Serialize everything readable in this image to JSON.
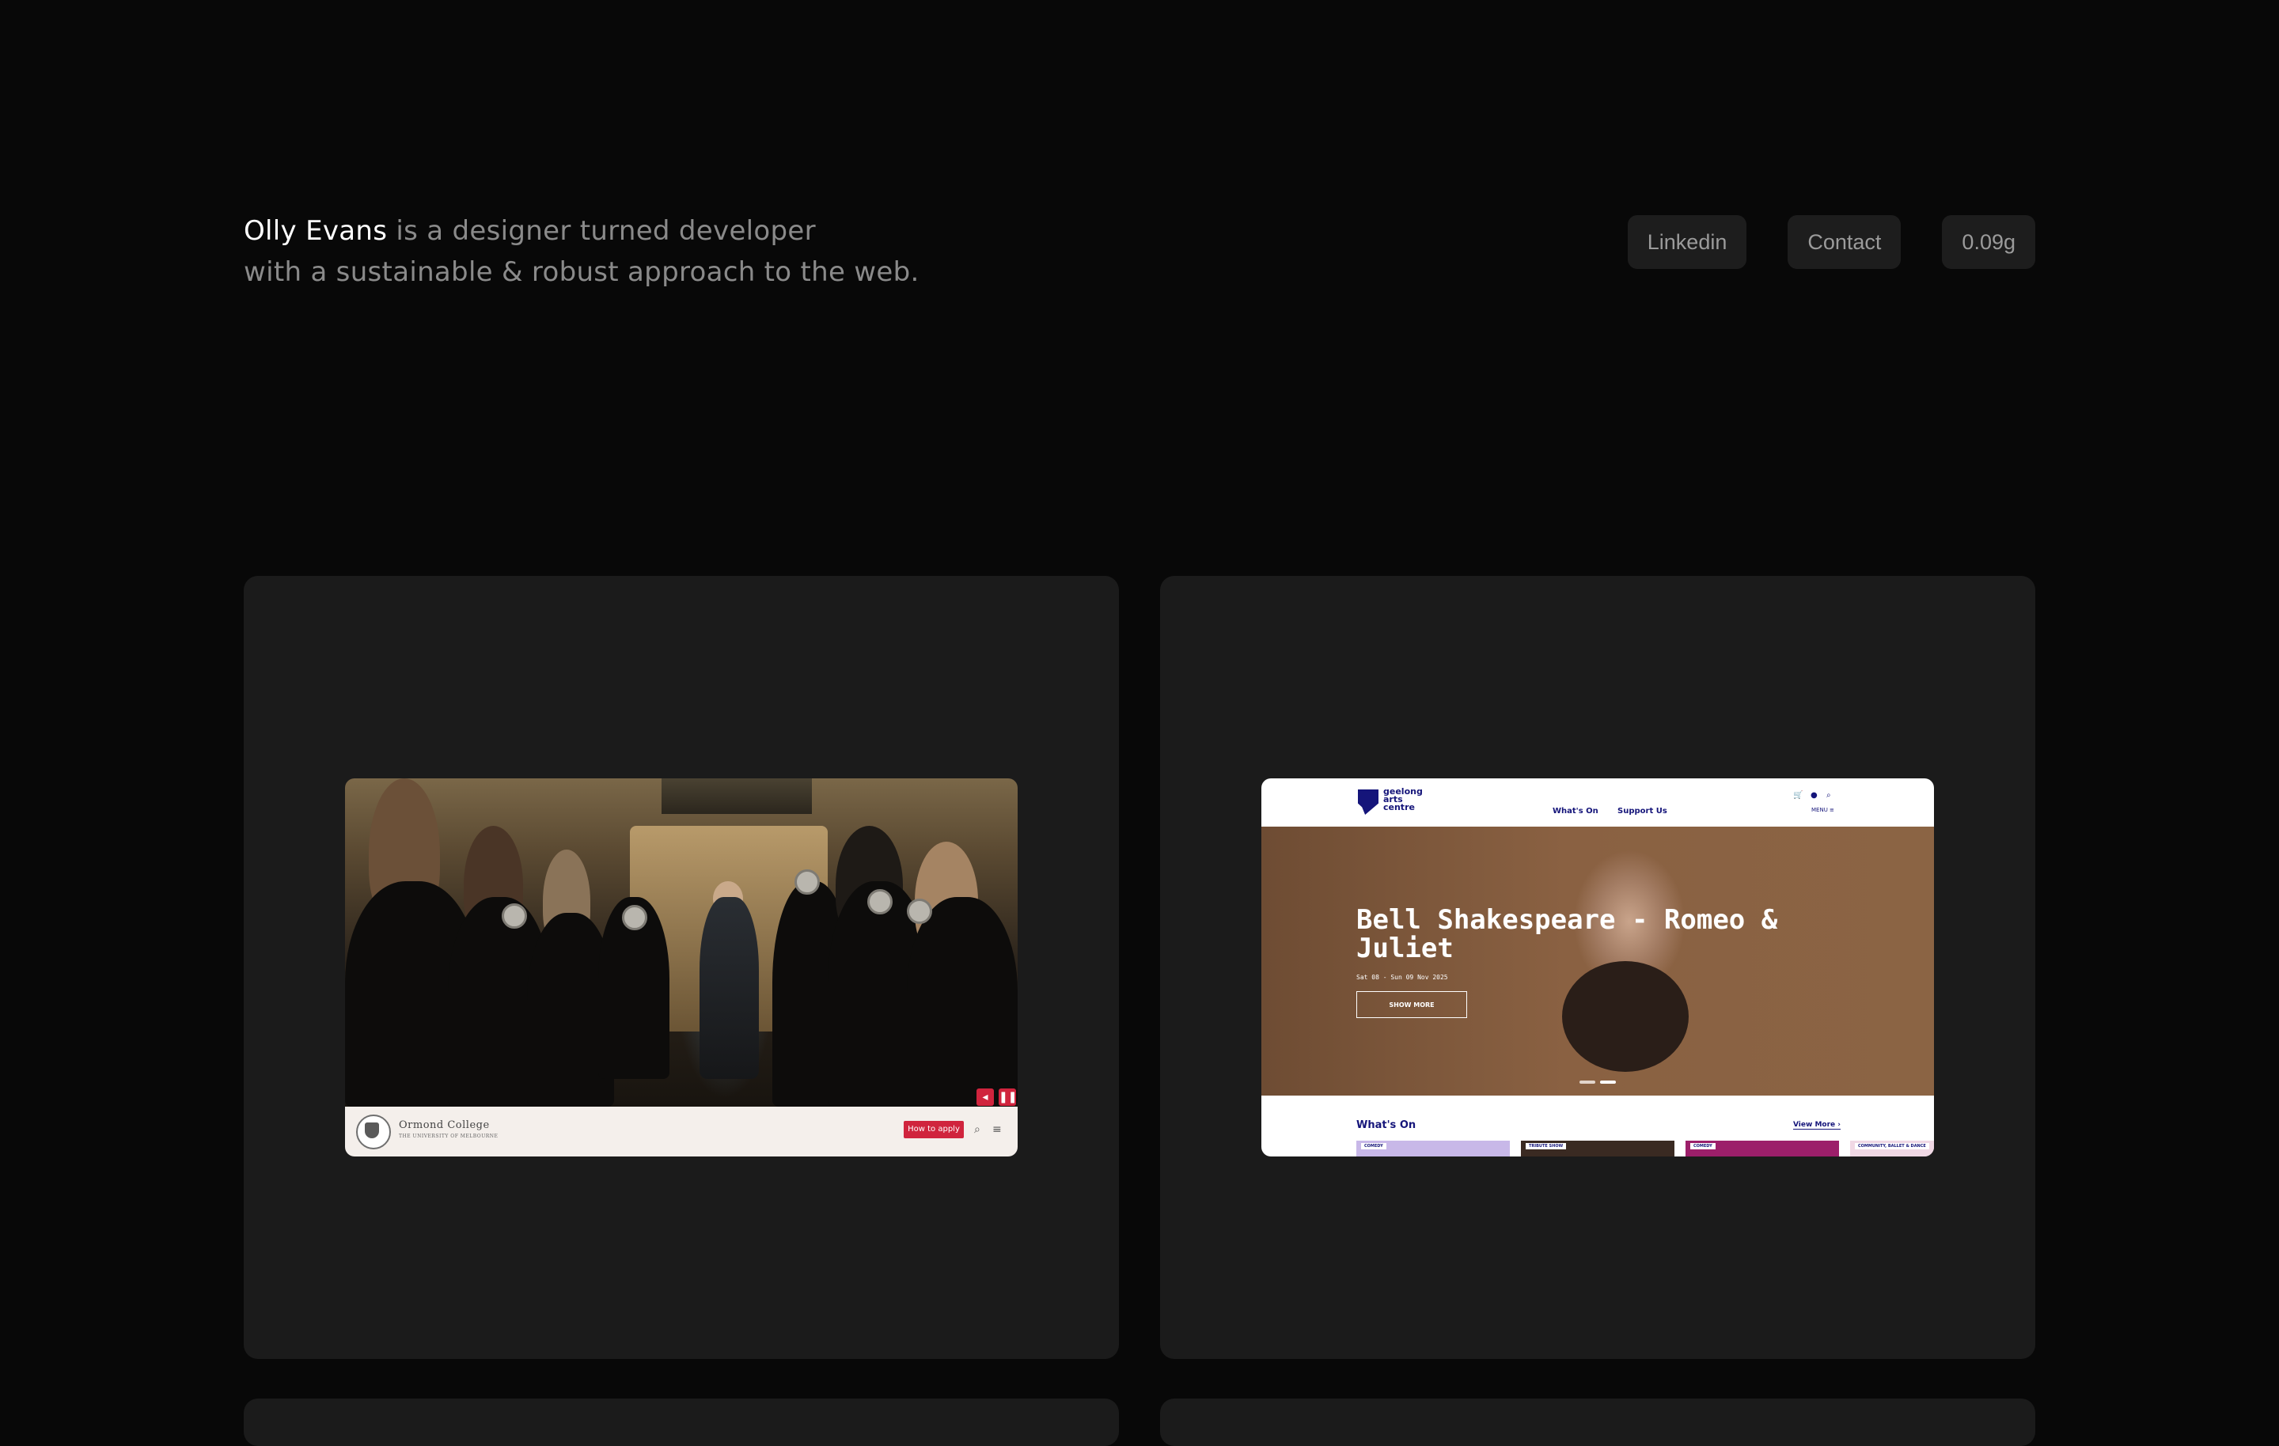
{
  "intro": {
    "name": "Olly Evans",
    "tagline_1": " is a designer turned developer",
    "tagline_2": "with a sustainable & robust approach to the web."
  },
  "nav": {
    "linkedin": "Linkedin",
    "contact": "Contact",
    "carbon": "0.09g"
  },
  "projects": {
    "ormond": {
      "college_name": "Ormond College",
      "college_sub": "THE UNIVERSITY OF MELBOURNE",
      "apply_label": "How to apply",
      "mute_icon": "◂",
      "pause_icon": "❚❚",
      "search_icon": "⌕",
      "menu_icon": "≡"
    },
    "geelong": {
      "logo_text": "geelong\narts\ncentre",
      "nav_whats_on": "What's On",
      "nav_support": "Support Us",
      "cart_icon": "🛒",
      "user_icon": "●",
      "search_icon": "⌕",
      "menu_label": "MENU ≡",
      "hero_title": "Bell Shakespeare - Romeo & Juliet",
      "hero_date": "Sat 08 - Sun 09 Nov 2025",
      "hero_button": "SHOW MORE",
      "section_title": "What's On",
      "view_more": "View More ›",
      "tile_tags": [
        "COMEDY",
        "TRIBUTE SHOW",
        "COMEDY",
        "COMMUNITY, BALLET & DANCE"
      ]
    }
  },
  "colors": {
    "background": "#080808",
    "card": "#1b1b1b",
    "pill": "#1d1d1d",
    "ormond_red": "#d0243d",
    "geelong_navy": "#15157a"
  }
}
